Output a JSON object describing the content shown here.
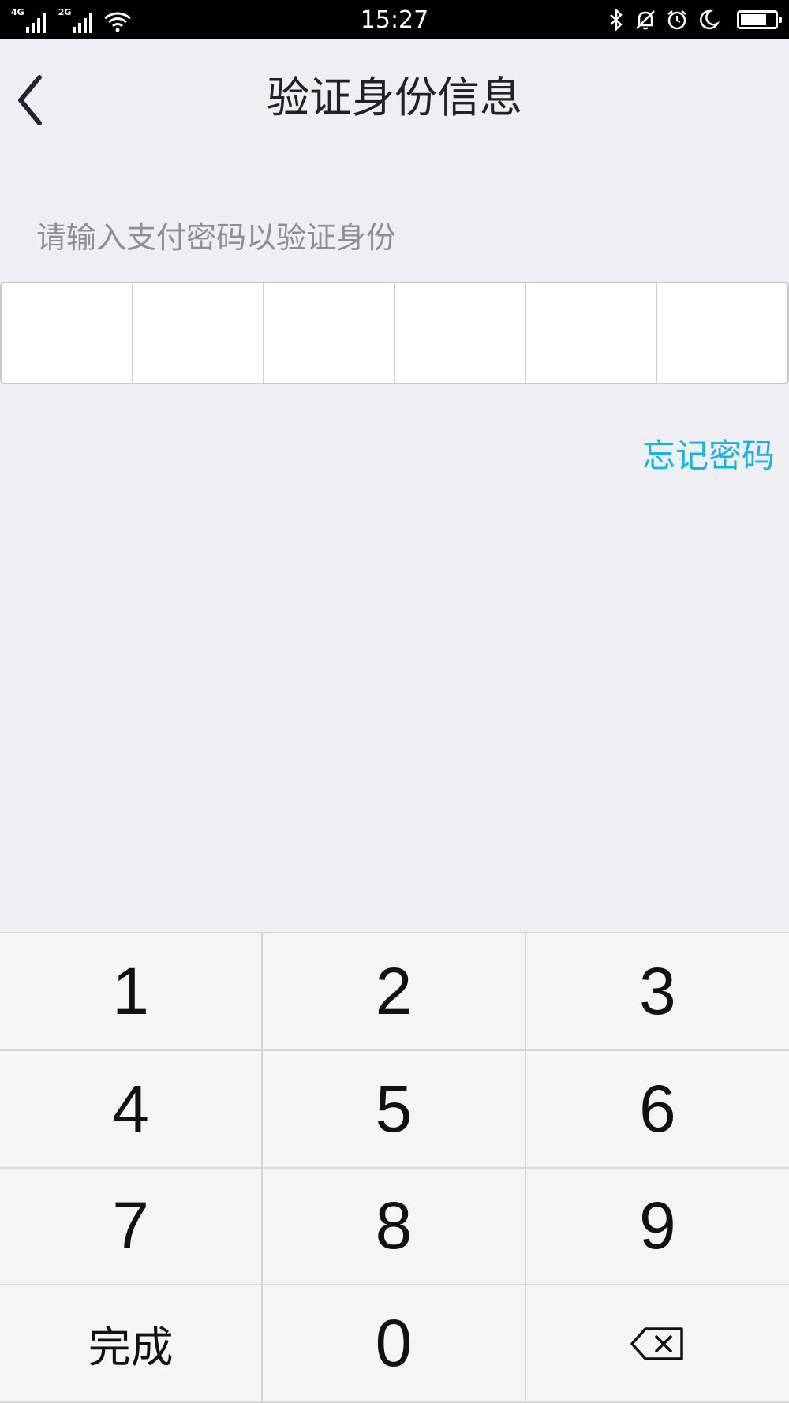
{
  "status_bar": {
    "network_1": "4G",
    "network_2": "2G",
    "time": "15:27",
    "battery_level": 0.75,
    "icons": [
      "signal-icon",
      "signal-icon",
      "wifi-icon",
      "bluetooth-icon",
      "bell-off-icon",
      "alarm-icon",
      "moon-icon",
      "battery-icon"
    ]
  },
  "header": {
    "back_icon": "chevron-left-icon",
    "title": "验证身份信息"
  },
  "form": {
    "prompt": "请输入支付密码以验证身份",
    "pin_length": 6,
    "forgot_password": "忘记密码"
  },
  "keypad": {
    "keys": [
      "1",
      "2",
      "3",
      "4",
      "5",
      "6",
      "7",
      "8",
      "9",
      "完成",
      "0",
      ""
    ],
    "backspace_icon": "backspace-icon"
  },
  "colors": {
    "background": "#efeef3",
    "accent": "#18b4e0",
    "status_bar": "#000000"
  }
}
